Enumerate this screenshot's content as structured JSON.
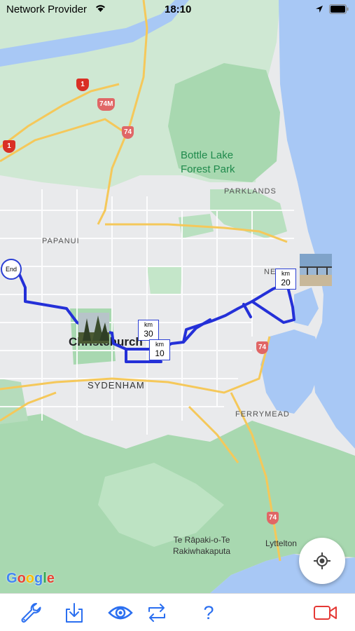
{
  "status_bar": {
    "carrier": "Network Provider",
    "time": "18:10"
  },
  "map": {
    "places": {
      "parklands": "PARKLANDS",
      "papanui": "PAPANUI",
      "sydenham": "SYDENHAM",
      "ferrymead": "FERRYMEAD",
      "new_brighton_partial": "NE",
      "christchurch": "Christchurch",
      "bottle_lake_line1": "Bottle Lake",
      "bottle_lake_line2": "Forest Park",
      "te_rapaki_line1": "Te Rāpaki-o-Te",
      "te_rapaki_line2": "Rakiwhakaputa",
      "lyttelton": "Lyttelton"
    },
    "road_shields": {
      "sh1_top": "1",
      "sh1_left": "1",
      "sh74m": "74M",
      "sh74_north": "74",
      "sh74_east": "74",
      "sh74_south": "74"
    },
    "route": {
      "end_label": "End",
      "markers": [
        {
          "unit": "km",
          "value": "30"
        },
        {
          "unit": "km",
          "value": "10"
        },
        {
          "unit": "km",
          "value": "20"
        }
      ]
    },
    "attribution": "Google"
  },
  "toolbar": {
    "help_label": "?"
  },
  "colors": {
    "water": "#a8c8f5",
    "park": "#a8d8b0",
    "land": "#e8eaed",
    "road_major": "#f5c85a",
    "route": "#2430d8",
    "accent": "#2b6ff0",
    "record": "#e53935"
  }
}
